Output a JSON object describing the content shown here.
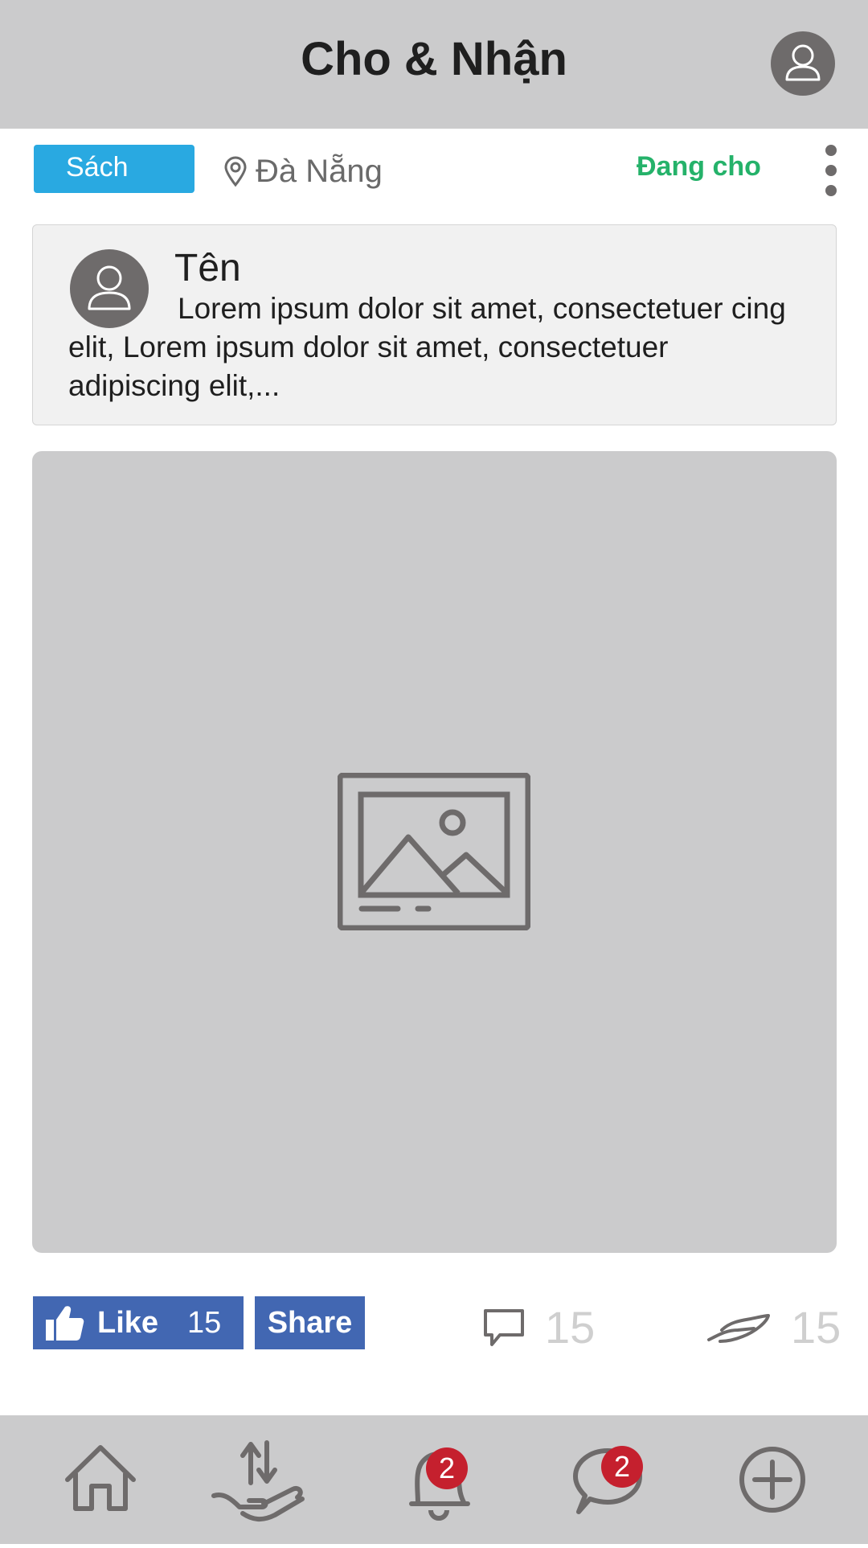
{
  "header": {
    "title": "Cho & Nhận"
  },
  "filters": {
    "category": "Sách",
    "location": "Đà Nẵng",
    "status": "Đang cho"
  },
  "post": {
    "name": "Tên",
    "text": "Lorem ipsum dolor sit amet, consectetuer cing elit, Lorem ipsum dolor sit amet, consectetuer adipiscing elit,..."
  },
  "actions": {
    "like_label": "Like",
    "like_count": "15",
    "share_label": "Share",
    "comment_count": "15",
    "give_count": "15"
  },
  "nav": {
    "notifications_badge": "2",
    "messages_badge": "2"
  },
  "colors": {
    "header_bg": "#cbcbcc",
    "category_chip": "#29a9e1",
    "status_green": "#25b26a",
    "facebook_blue": "#4267b2",
    "badge_red": "#c5202e",
    "icon_gray": "#6e6b6b"
  },
  "icons": {
    "profile": "user-icon",
    "location": "map-pin-icon",
    "more": "vertical-dots-icon",
    "image": "image-placeholder-icon",
    "like": "thumbs-up-icon",
    "comment": "speech-bubble-icon",
    "give": "giving-hand-icon",
    "home": "home-icon",
    "exchange": "hand-exchange-icon",
    "notifications": "bell-icon",
    "messages": "chat-icon",
    "add": "plus-circle-icon"
  }
}
